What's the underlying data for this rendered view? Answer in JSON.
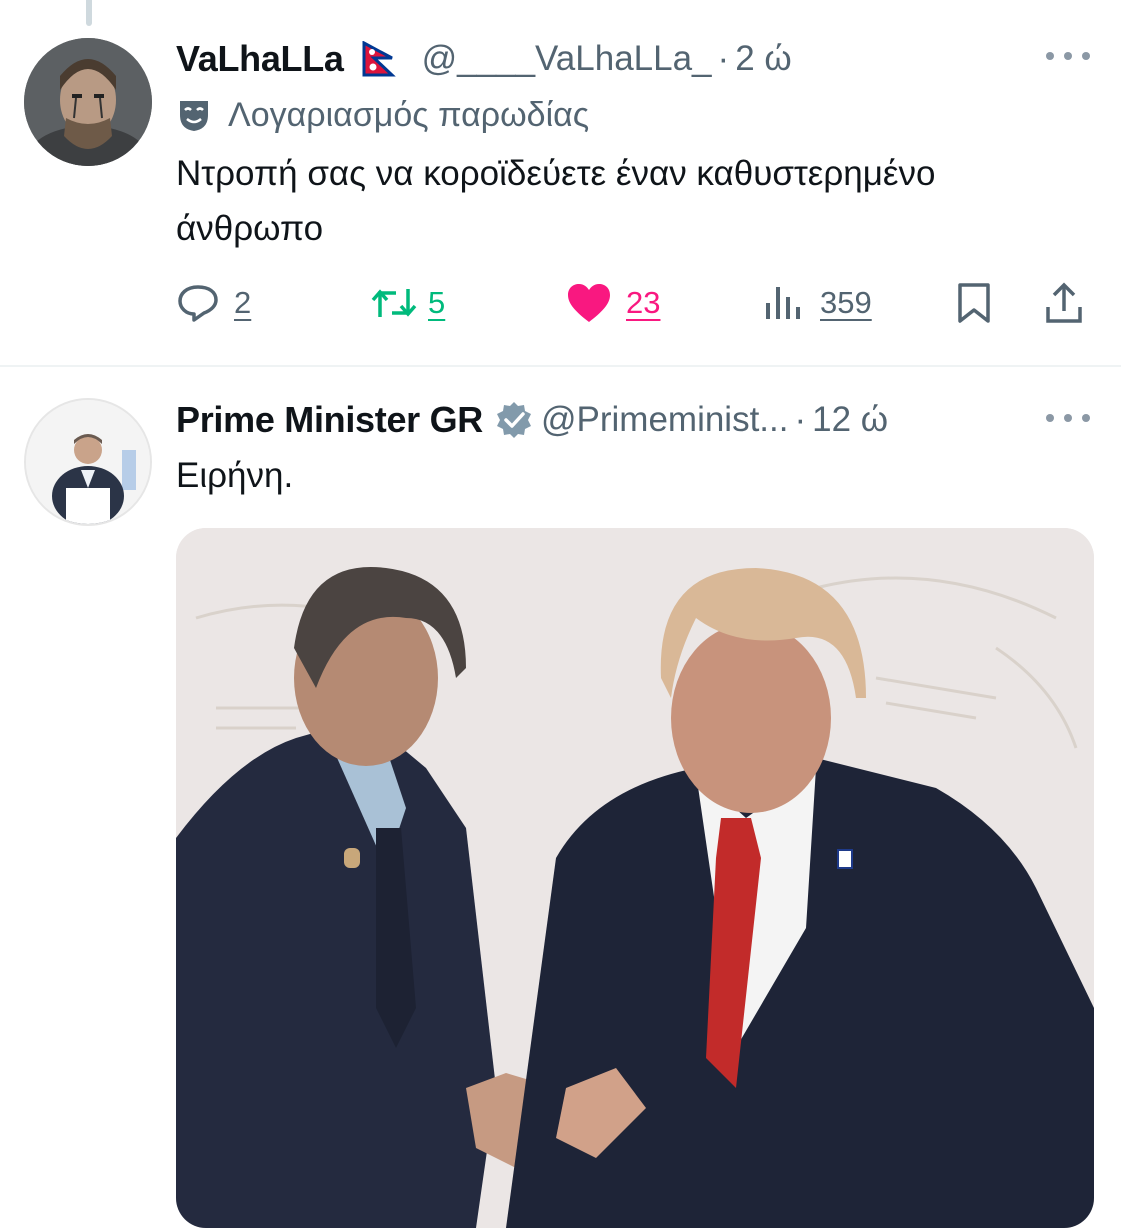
{
  "tweet1": {
    "display_name": "VaLhaLLa",
    "handle": "@____VaLhaLLa_",
    "separator": "·",
    "time": "2 ώ",
    "label": "Λογαριασμός παρωδίας",
    "text": "Ντροπή σας να κοροϊδεύετε έναν καθυστερημένο άνθρωπο",
    "replies": "2",
    "reposts": "5",
    "likes": "23",
    "views": "359"
  },
  "tweet2": {
    "display_name": "Prime Minister GR",
    "handle": "@Primeminist...",
    "separator": "·",
    "time": "12 ώ",
    "text": "Ειρήνη."
  },
  "colors": {
    "text_primary": "#0f1419",
    "text_secondary": "#536471",
    "repost": "#00ba7c",
    "like": "#f91880",
    "verified": "#829aab",
    "divider": "#eff3f4"
  },
  "icons": [
    "flag-icon",
    "more-icon",
    "mask-icon",
    "reply-icon",
    "repost-icon",
    "like-icon",
    "views-icon",
    "bookmark-icon",
    "share-icon",
    "verified-icon"
  ]
}
